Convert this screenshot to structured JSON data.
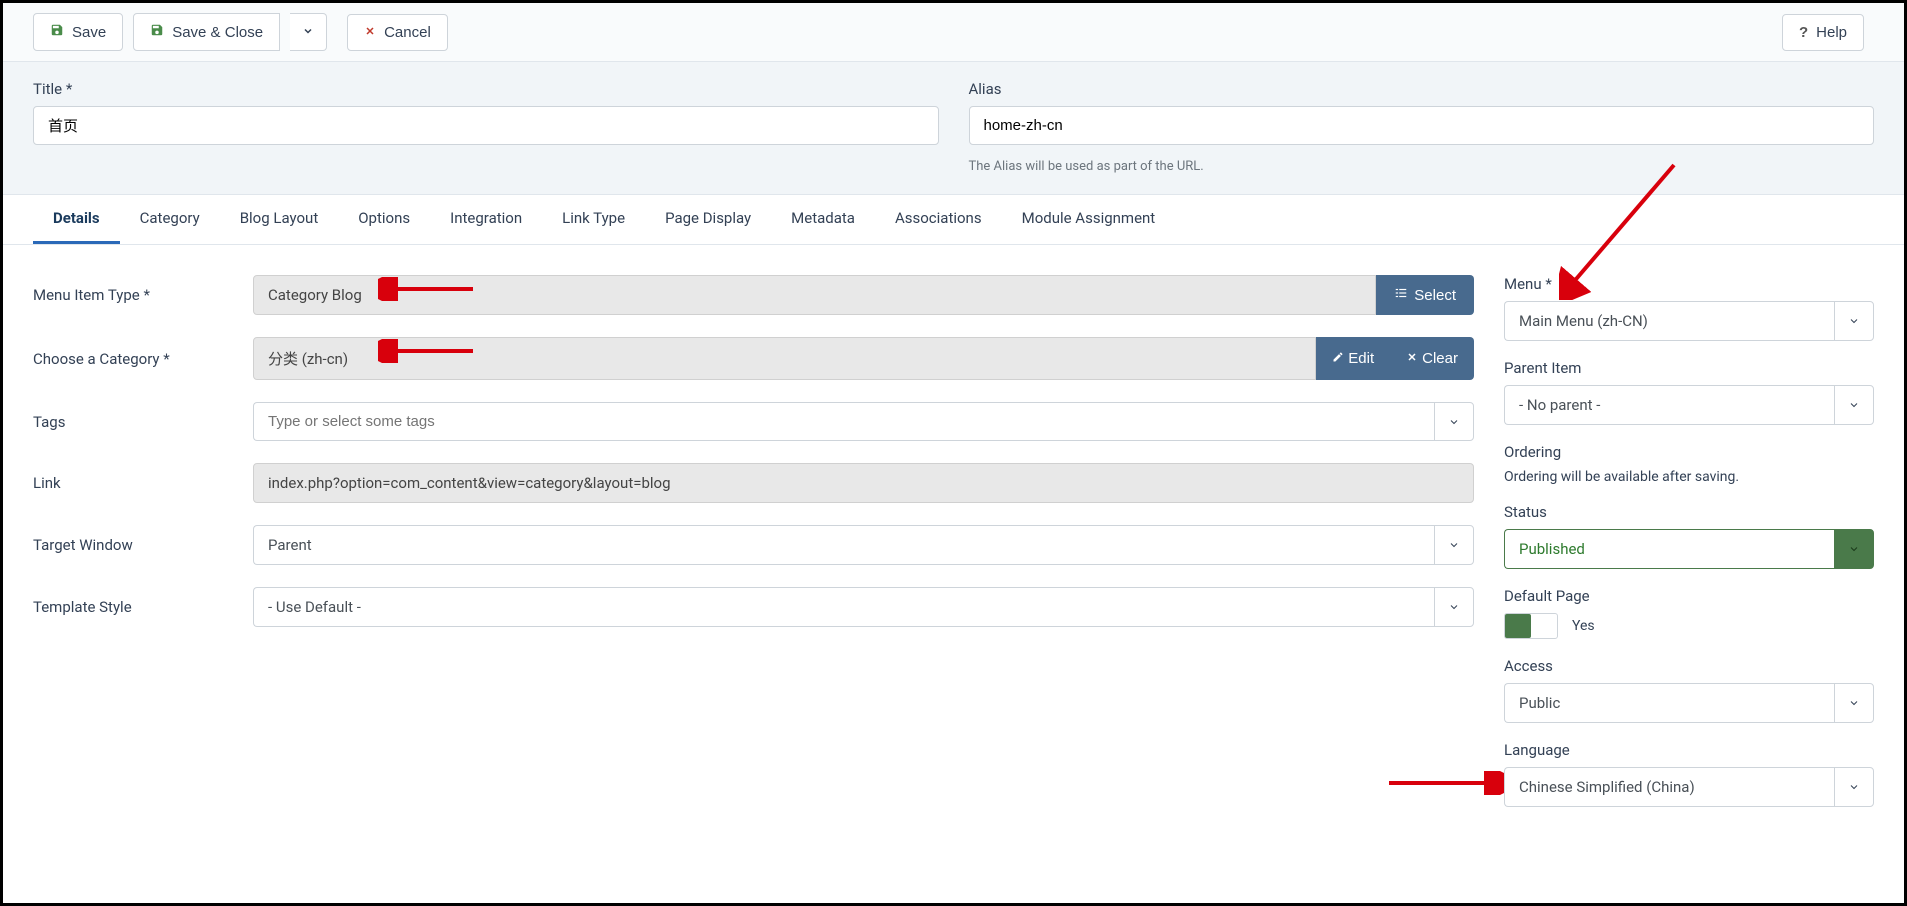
{
  "toolbar": {
    "save": "Save",
    "save_close": "Save & Close",
    "cancel": "Cancel",
    "help": "Help"
  },
  "title": {
    "label": "Title *",
    "value": "首页"
  },
  "alias": {
    "label": "Alias",
    "value": "home-zh-cn",
    "helper": "The Alias will be used as part of the URL."
  },
  "tabs": [
    "Details",
    "Category",
    "Blog Layout",
    "Options",
    "Integration",
    "Link Type",
    "Page Display",
    "Metadata",
    "Associations",
    "Module Assignment"
  ],
  "form": {
    "menu_item_type": {
      "label": "Menu Item Type *",
      "value": "Category Blog",
      "select_btn": "Select"
    },
    "choose_category": {
      "label": "Choose a Category *",
      "value": "分类 (zh-cn)",
      "edit_btn": "Edit",
      "clear_btn": "Clear"
    },
    "tags": {
      "label": "Tags",
      "placeholder": "Type or select some tags"
    },
    "link": {
      "label": "Link",
      "value": "index.php?option=com_content&view=category&layout=blog"
    },
    "target_window": {
      "label": "Target Window",
      "value": "Parent"
    },
    "template_style": {
      "label": "Template Style",
      "value": "- Use Default -"
    }
  },
  "side": {
    "menu": {
      "label": "Menu *",
      "value": "Main Menu (zh-CN)"
    },
    "parent_item": {
      "label": "Parent Item",
      "value": "- No parent -"
    },
    "ordering": {
      "label": "Ordering",
      "text": "Ordering will be available after saving."
    },
    "status": {
      "label": "Status",
      "value": "Published"
    },
    "default_page": {
      "label": "Default Page",
      "value": "Yes"
    },
    "access": {
      "label": "Access",
      "value": "Public"
    },
    "language": {
      "label": "Language",
      "value": "Chinese Simplified (China)"
    }
  }
}
